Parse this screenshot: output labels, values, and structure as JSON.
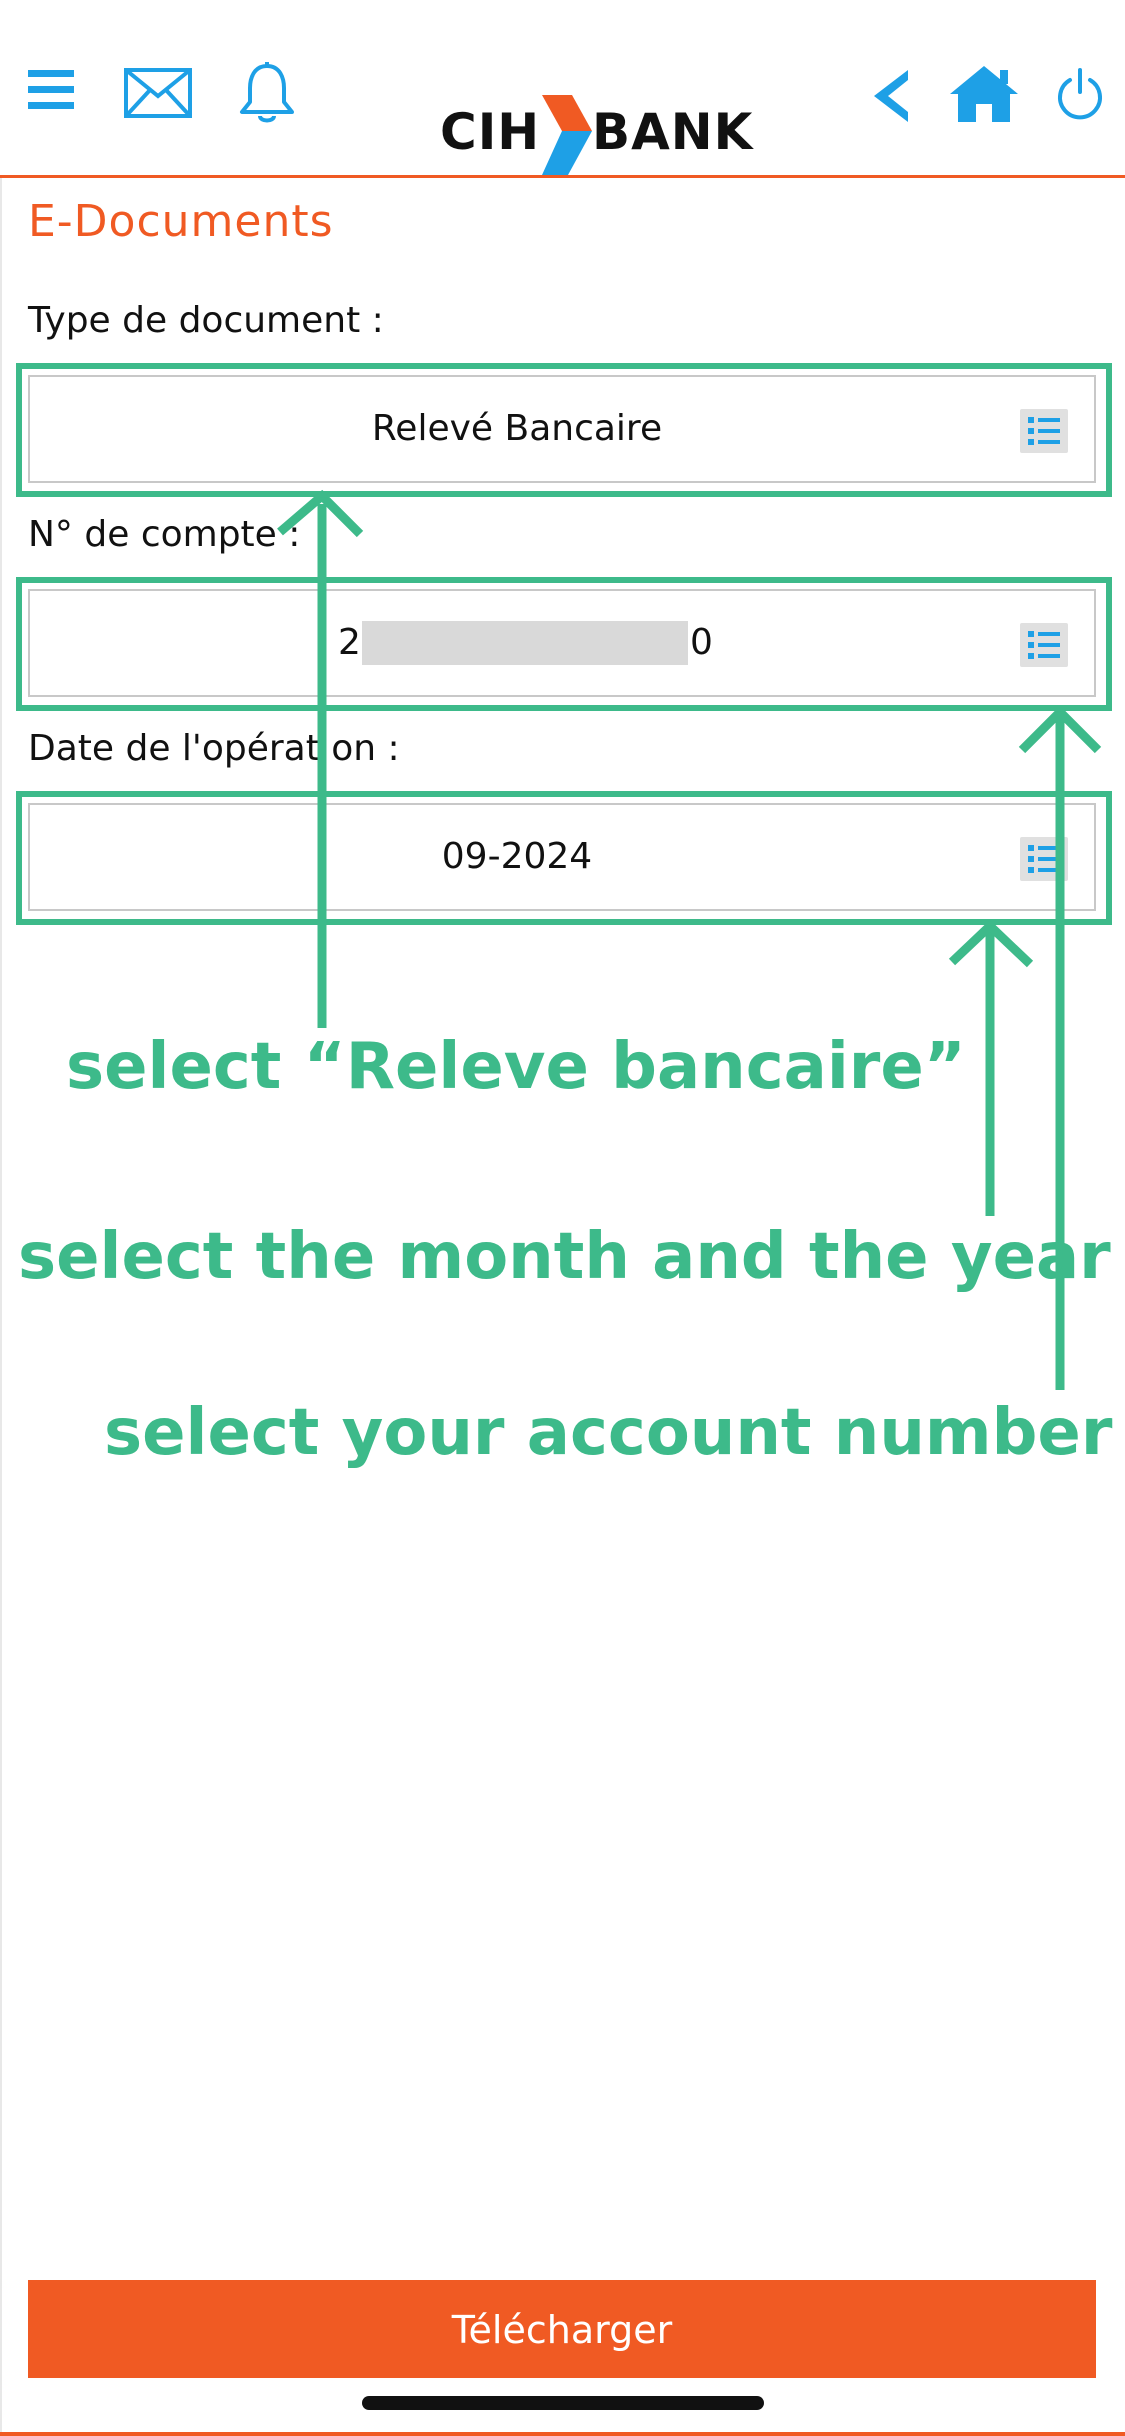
{
  "header": {
    "logo_left": "CIH",
    "logo_right": "BANK",
    "icons": {
      "menu": "menu-icon",
      "mail": "mail-icon",
      "bell": "bell-icon",
      "back": "back-icon",
      "home": "home-icon",
      "power": "power-icon"
    },
    "accent_color": "#1ea0e6",
    "brand_orange": "#f05a23"
  },
  "page": {
    "title": "E-Documents"
  },
  "form": {
    "type_label": "Type de document :",
    "type_value": "Relevé Bancaire",
    "account_label": "N° de compte :",
    "account_prefix": "2",
    "account_suffix": "0",
    "date_label": "Date de l'opérat on :",
    "date_value": "09-2024"
  },
  "annotations": {
    "select_type": "select “Releve bancaire”",
    "select_month": "select the month and the year",
    "select_account": "select your account number",
    "color": "#3dba8a"
  },
  "footer": {
    "download_label": "Télécharger"
  }
}
